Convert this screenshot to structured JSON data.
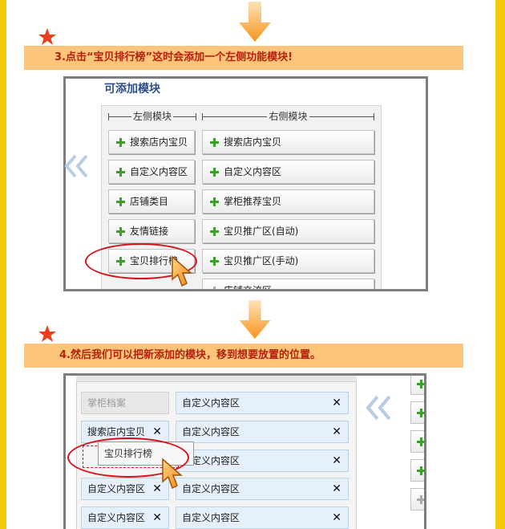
{
  "step3": {
    "instruction": "3.点击“宝贝排行榜”这时会添加一个左侧功能模块!"
  },
  "panel1": {
    "title": "可添加模块",
    "left_header": "左侧模块",
    "right_header": "右侧模块",
    "left_modules": [
      "搜索店内宝贝",
      "自定义内容区",
      "店铺类目",
      "友情链接",
      "宝贝排行榜"
    ],
    "right_modules": [
      "搜索店内宝贝",
      "自定义内容区",
      "掌柜推荐宝贝",
      "宝贝推广区(自动)",
      "宝贝推广区(手动)",
      "店铺交流区"
    ]
  },
  "step4": {
    "instruction": "4.然后我们可以把新添加的模块，移到想要放置的位置。"
  },
  "panel2": {
    "left_cells": [
      "掌柜档案",
      "搜索店内宝贝",
      "",
      "自定义内容区",
      "自定义内容区"
    ],
    "right_cells": [
      "自定义内容区",
      "自定义内容区",
      "自定义内容区",
      "自定义内容区",
      "自定义内容区"
    ],
    "dragging_label": "宝贝排行榜",
    "remove_symbol": "✕"
  },
  "colors": {
    "page_background": "#f3c90a",
    "banner": "#fdc57a",
    "banner_text": "#b5200e",
    "arrow": "#f7941d",
    "highlight": "#d6121b",
    "cell_blue": "#e6f0fa"
  },
  "icons": [
    "down-arrow-icon",
    "star-icon",
    "plus-icon",
    "double-chevron-left-icon",
    "hand-pointer-cursor-icon",
    "close-icon"
  ]
}
